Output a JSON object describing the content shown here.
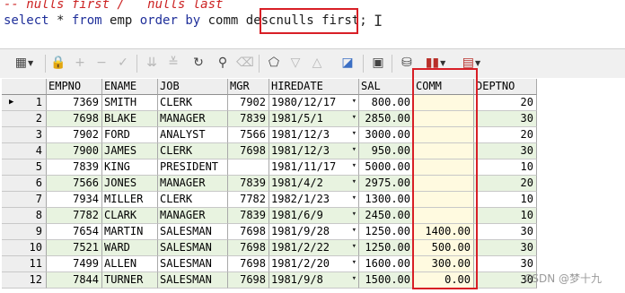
{
  "editor": {
    "comment": "-- nulls first /   nulls last",
    "sql": {
      "kw_select": "select",
      "rest1": " * ",
      "kw_from": "from",
      "rest2": " emp ",
      "kw_order": "order",
      "rest3": " ",
      "kw_by": "by",
      "rest4": " comm desc",
      "highlighted": "nulls first;"
    }
  },
  "toolbar": {
    "icons": [
      "grid-icon",
      "lock-icon",
      "plus-icon",
      "minus-icon",
      "check-icon",
      "filter-down-icon",
      "filter-clear-icon",
      "refresh-icon",
      "find-icon",
      "clear-icon",
      "record-icon",
      "triangle-down-icon",
      "triangle-up-icon",
      "chart-icon",
      "save-icon",
      "query-by-example-icon",
      "bar-chart-icon",
      "export-icon"
    ]
  },
  "colors": {
    "row_even": "#ffffff",
    "row_odd": "#e8f3e0",
    "comm_col": "#fffae0",
    "highlight": "#d81f26"
  },
  "grid": {
    "columns": [
      "EMPNO",
      "ENAME",
      "JOB",
      "MGR",
      "HIREDATE",
      "SAL",
      "COMM",
      "DEPTNO"
    ],
    "rows": [
      {
        "n": "1",
        "empno": "7369",
        "ename": "SMITH",
        "job": "CLERK",
        "mgr": "7902",
        "hiredate": "1980/12/17",
        "sal": "800.00",
        "comm": "",
        "deptno": "20"
      },
      {
        "n": "2",
        "empno": "7698",
        "ename": "BLAKE",
        "job": "MANAGER",
        "mgr": "7839",
        "hiredate": "1981/5/1",
        "sal": "2850.00",
        "comm": "",
        "deptno": "30"
      },
      {
        "n": "3",
        "empno": "7902",
        "ename": "FORD",
        "job": "ANALYST",
        "mgr": "7566",
        "hiredate": "1981/12/3",
        "sal": "3000.00",
        "comm": "",
        "deptno": "20"
      },
      {
        "n": "4",
        "empno": "7900",
        "ename": "JAMES",
        "job": "CLERK",
        "mgr": "7698",
        "hiredate": "1981/12/3",
        "sal": "950.00",
        "comm": "",
        "deptno": "30"
      },
      {
        "n": "5",
        "empno": "7839",
        "ename": "KING",
        "job": "PRESIDENT",
        "mgr": "",
        "hiredate": "1981/11/17",
        "sal": "5000.00",
        "comm": "",
        "deptno": "10"
      },
      {
        "n": "6",
        "empno": "7566",
        "ename": "JONES",
        "job": "MANAGER",
        "mgr": "7839",
        "hiredate": "1981/4/2",
        "sal": "2975.00",
        "comm": "",
        "deptno": "20"
      },
      {
        "n": "7",
        "empno": "7934",
        "ename": "MILLER",
        "job": "CLERK",
        "mgr": "7782",
        "hiredate": "1982/1/23",
        "sal": "1300.00",
        "comm": "",
        "deptno": "10"
      },
      {
        "n": "8",
        "empno": "7782",
        "ename": "CLARK",
        "job": "MANAGER",
        "mgr": "7839",
        "hiredate": "1981/6/9",
        "sal": "2450.00",
        "comm": "",
        "deptno": "10"
      },
      {
        "n": "9",
        "empno": "7654",
        "ename": "MARTIN",
        "job": "SALESMAN",
        "mgr": "7698",
        "hiredate": "1981/9/28",
        "sal": "1250.00",
        "comm": "1400.00",
        "deptno": "30"
      },
      {
        "n": "10",
        "empno": "7521",
        "ename": "WARD",
        "job": "SALESMAN",
        "mgr": "7698",
        "hiredate": "1981/2/22",
        "sal": "1250.00",
        "comm": "500.00",
        "deptno": "30"
      },
      {
        "n": "11",
        "empno": "7499",
        "ename": "ALLEN",
        "job": "SALESMAN",
        "mgr": "7698",
        "hiredate": "1981/2/20",
        "sal": "1600.00",
        "comm": "300.00",
        "deptno": "30"
      },
      {
        "n": "12",
        "empno": "7844",
        "ename": "TURNER",
        "job": "SALESMAN",
        "mgr": "7698",
        "hiredate": "1981/9/8",
        "sal": "1500.00",
        "comm": "0.00",
        "deptno": "30"
      }
    ]
  },
  "watermark": "CSDN @梦十九"
}
